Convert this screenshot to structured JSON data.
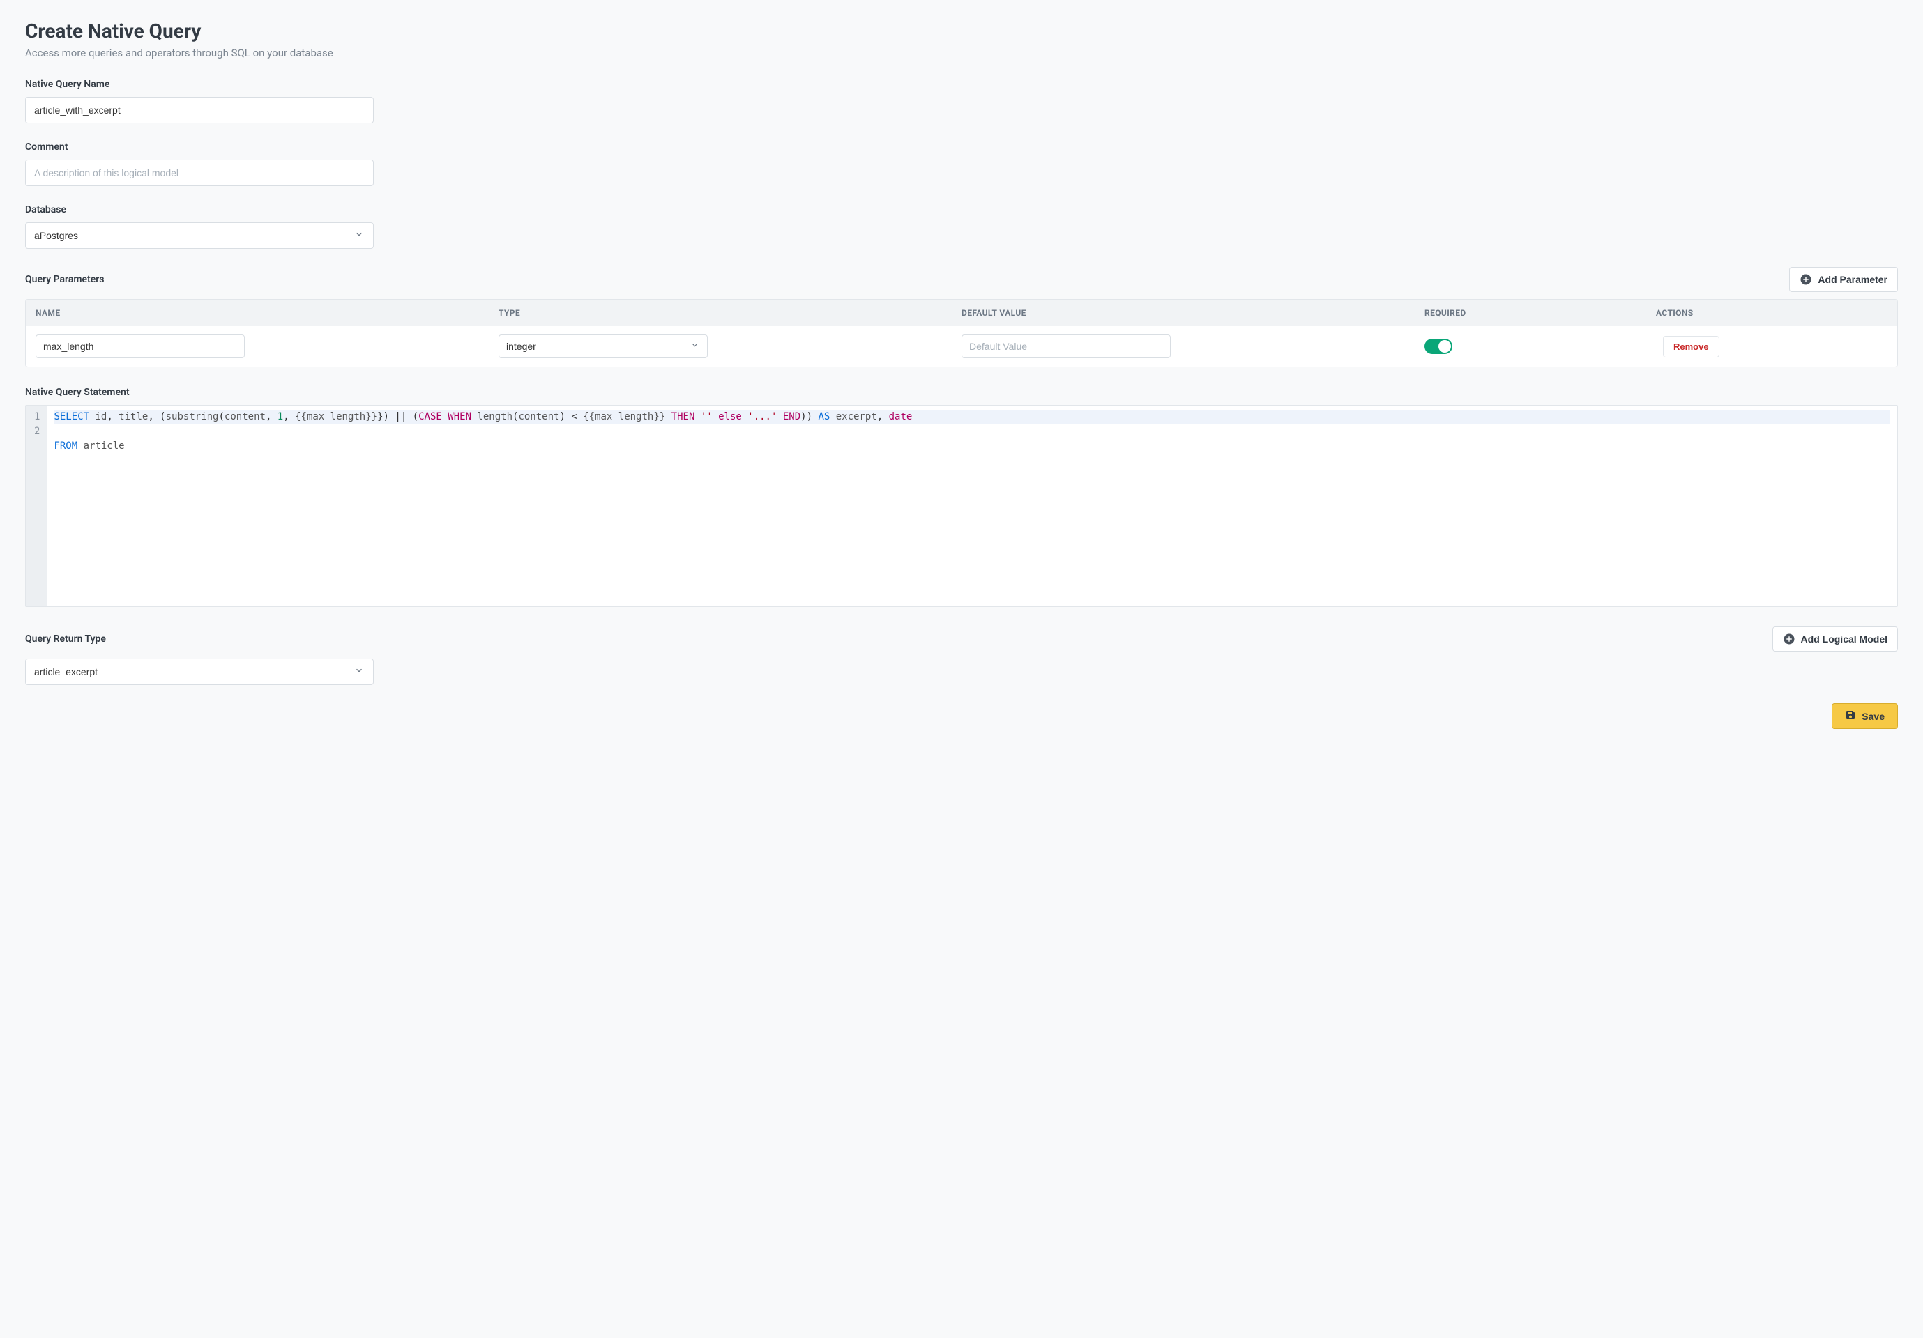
{
  "header": {
    "title": "Create Native Query",
    "subtitle": "Access more queries and operators through SQL on your database"
  },
  "fields": {
    "name_label": "Native Query Name",
    "name_value": "article_with_excerpt",
    "comment_label": "Comment",
    "comment_placeholder": "A description of this logical model",
    "database_label": "Database",
    "database_value": "aPostgres"
  },
  "parameters": {
    "label": "Query Parameters",
    "add_button": "Add Parameter",
    "columns": {
      "name": "NAME",
      "type": "TYPE",
      "default": "DEFAULT VALUE",
      "required": "REQUIRED",
      "actions": "ACTIONS"
    },
    "rows": [
      {
        "name": "max_length",
        "type": "integer",
        "default_placeholder": "Default Value",
        "required": true,
        "remove_label": "Remove"
      }
    ]
  },
  "statement": {
    "label": "Native Query Statement",
    "lines": [
      "1",
      "2"
    ],
    "tokens": {
      "select": "SELECT",
      "from": "FROM",
      "as": "AS",
      "case": "CASE",
      "when": "WHEN",
      "then": "THEN",
      "else": "else",
      "end": "END",
      "num1": "1",
      "id": "id",
      "title": "title",
      "substring": "substring",
      "content": "content",
      "max_length_tmpl": "{{max_length}}",
      "length": "length",
      "lt": "<",
      "empty_str": "''",
      "ellipsis_str": "'...'",
      "excerpt": "excerpt",
      "date": "date",
      "article": "article"
    }
  },
  "return_type": {
    "label": "Query Return Type",
    "add_button": "Add Logical Model",
    "value": "article_excerpt"
  },
  "actions": {
    "save": "Save"
  }
}
